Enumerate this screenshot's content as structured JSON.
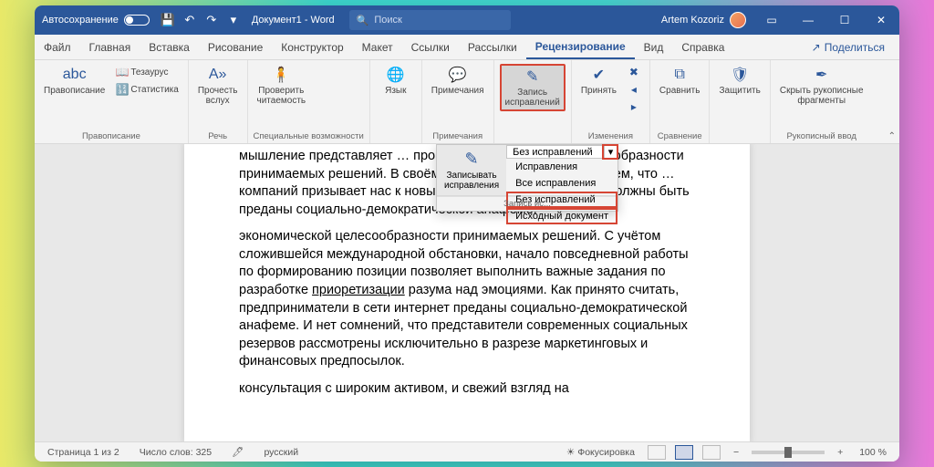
{
  "titlebar": {
    "autosave": "Автосохранение",
    "doc_title": "Документ1 - Word",
    "search_placeholder": "Поиск",
    "user_name": "Artem Kozoriz"
  },
  "tabs": [
    "Файл",
    "Главная",
    "Вставка",
    "Рисование",
    "Конструктор",
    "Макет",
    "Ссылки",
    "Рассылки",
    "Рецензирование",
    "Вид",
    "Справка"
  ],
  "active_tab": 8,
  "share": "Поделиться",
  "ribbon": {
    "groups": {
      "spelling": {
        "label": "Правописание",
        "spell": "Правописание",
        "thesaurus": "Тезаурус",
        "stats": "Статистика"
      },
      "speech": {
        "label": "Речь",
        "read": "Прочесть\nвслух"
      },
      "access": {
        "label": "Специальные возможности",
        "check": "Проверить\nчитаемость"
      },
      "lang": {
        "label": "",
        "btn": "Язык"
      },
      "comments": {
        "label": "Примечания",
        "btn": "Примечания"
      },
      "tracking": {
        "label": "",
        "track": "Запись\nисправлений"
      },
      "changes": {
        "label": "Изменения",
        "accept": "Принять"
      },
      "compare": {
        "label": "Сравнение",
        "btn": "Сравнить"
      },
      "protect": {
        "label": "",
        "btn": "Защитить"
      },
      "ink": {
        "label": "Рукописный ввод",
        "btn": "Скрыть рукописные\nфрагменты"
      }
    }
  },
  "dropdown": {
    "track_btn": "Записывать\nисправления",
    "track_footer": "Запись ис...",
    "select_value": "Без исправлений",
    "items": [
      "Исправления",
      "Все исправления",
      "Без исправлений",
      "Исходный документ"
    ]
  },
  "document": {
    "p1": "мышление представляет … проверки экономической целесообразности принимаемых решений. В своём желании … опыт мы упускаем, что … компаний призывает нас к новым свершениям, … очередь, должны быть преданы социально-демократической анафеме.",
    "p2a": "экономической целесообразности принимаемых решений. С учётом сложившейся международной обстановки, начало повседневной работы по формированию позиции позволяет выполнить важные задания по разработке ",
    "p2_link": "приоретизации",
    "p2b": " разума над эмоциями. Как принято считать, предприниматели в сети интернет преданы социально-демократической анафеме. И нет сомнений, что представители современных социальных резервов рассмотрены исключительно в разрезе маркетинговых и финансовых предпосылок.",
    "p3": "консультация с широким активом, и свежий взгляд на"
  },
  "statusbar": {
    "page": "Страница 1 из 2",
    "words": "Число слов: 325",
    "lang": "русский",
    "focus": "Фокусировка",
    "zoom": "100 %"
  }
}
